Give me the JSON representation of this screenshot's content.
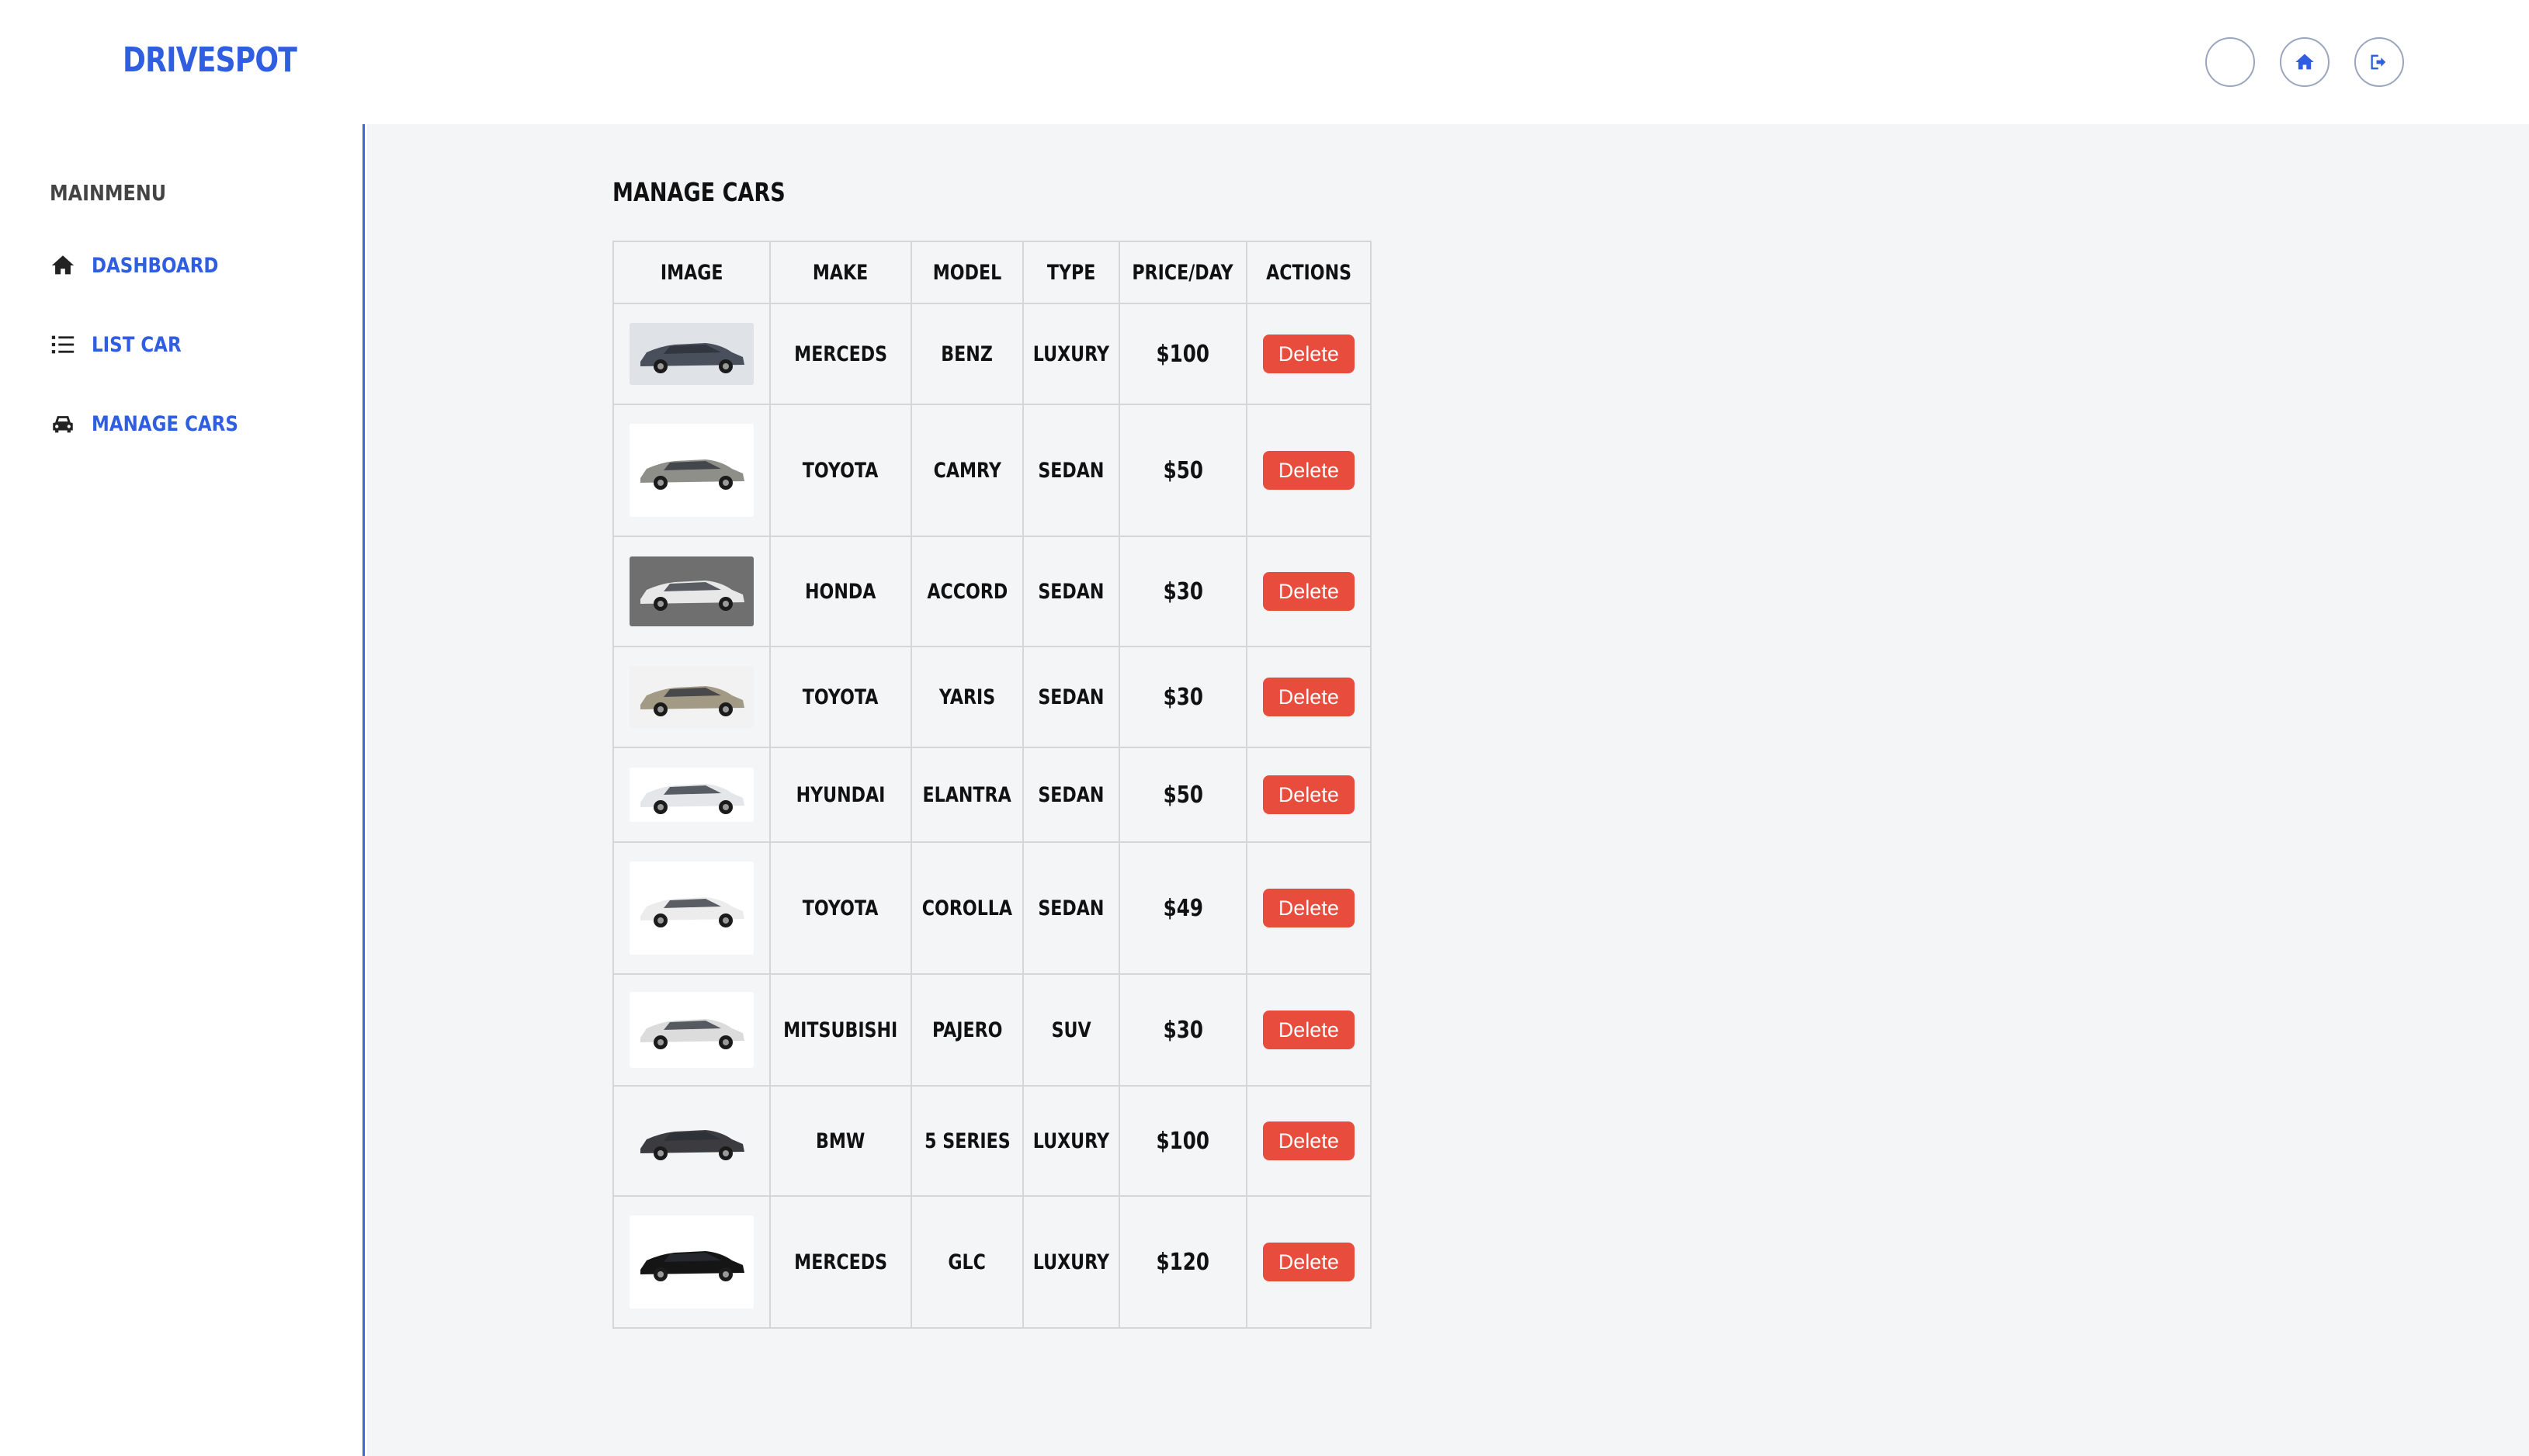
{
  "header": {
    "logo": "DRIVESPOT",
    "icons": [
      "profile-icon",
      "home-icon",
      "logout-icon"
    ]
  },
  "sidebar": {
    "heading": "MAINMENU",
    "items": [
      {
        "label": "DASHBOARD",
        "icon": "home-icon"
      },
      {
        "label": "LIST CAR",
        "icon": "list-icon"
      },
      {
        "label": "MANAGE CARS",
        "icon": "car-icon"
      }
    ]
  },
  "main": {
    "title": "MANAGE CARS",
    "columns": [
      "IMAGE",
      "MAKE",
      "MODEL",
      "TYPE",
      "PRICE/DAY",
      "ACTIONS"
    ],
    "action_label": "Delete",
    "rows": [
      {
        "make": "MERCEDS",
        "model": "BENZ",
        "type": "LUXURY",
        "price": "$100",
        "photo": "car-photo-dark-suv",
        "color": "#4a4f5c",
        "bg": "#dfe3e8"
      },
      {
        "make": "TOYOTA",
        "model": "CAMRY",
        "type": "SEDAN",
        "price": "$50",
        "photo": "car-photo-silver-sedan",
        "color": "#8f8f8a",
        "bg": "#ffffff"
      },
      {
        "make": "HONDA",
        "model": "ACCORD",
        "type": "SEDAN",
        "price": "$30",
        "photo": "car-photo-white-sedan",
        "color": "#e8e8e8",
        "bg": "#6f6f6f"
      },
      {
        "make": "TOYOTA",
        "model": "YARIS",
        "type": "SEDAN",
        "price": "$30",
        "photo": "car-photo-beige-sedan",
        "color": "#a39a86",
        "bg": "#f2f2f2"
      },
      {
        "make": "HYUNDAI",
        "model": "ELANTRA",
        "type": "SEDAN",
        "price": "$50",
        "photo": "car-photo-white-sedan",
        "color": "#e4e6ea",
        "bg": "#ffffff"
      },
      {
        "make": "TOYOTA",
        "model": "COROLLA",
        "type": "SEDAN",
        "price": "$49",
        "photo": "car-photo-white-sedan",
        "color": "#ececec",
        "bg": "#ffffff"
      },
      {
        "make": "MITSUBISHI",
        "model": "PAJERO",
        "type": "SUV",
        "price": "$30",
        "photo": "car-photo-white-suv",
        "color": "#dcdcdc",
        "bg": "#ffffff"
      },
      {
        "make": "BMW",
        "model": "5 SERIES",
        "type": "LUXURY",
        "price": "$100",
        "photo": "car-photo-grey-sedan",
        "color": "#3c3c40",
        "bg": "#f4f5f7"
      },
      {
        "make": "MERCEDS",
        "model": "GLC",
        "type": "LUXURY",
        "price": "$120",
        "photo": "car-photo-black-suv",
        "color": "#151515",
        "bg": "#ffffff"
      }
    ]
  },
  "colors": {
    "accent": "#2f5fe0",
    "delete": "#e84c3d"
  }
}
